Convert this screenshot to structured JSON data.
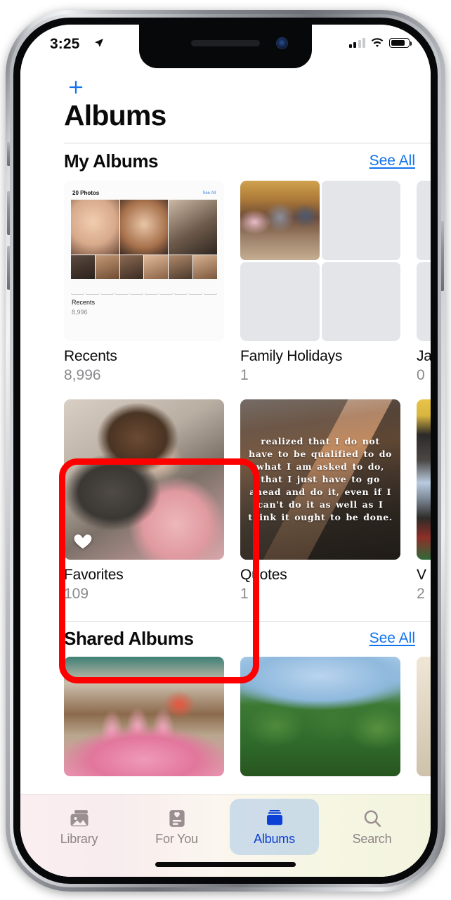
{
  "status_bar": {
    "time": "3:25",
    "location_icon": "location-arrow-icon",
    "cellular_icon": "cellular-bars-icon",
    "cellular_bars_filled": 2,
    "cellular_bars_total": 4,
    "wifi_icon": "wifi-icon",
    "battery_icon": "battery-icon",
    "battery_level_percent": 75
  },
  "nav": {
    "add_icon": "plus-icon",
    "title": "Albums"
  },
  "sections": [
    {
      "title": "My Albums",
      "see_all_label": "See All",
      "rows": [
        [
          {
            "name": "Recents",
            "count": "8,996",
            "thumb": "nested-photos-screenshot"
          },
          {
            "name": "Family Holidays",
            "count": "1",
            "thumb": "quad-grid-family-photo"
          },
          {
            "name": "Ja",
            "count": "0",
            "thumb": "quad-grid-empty",
            "cut_off": true
          }
        ],
        [
          {
            "name": "Favorites",
            "count": "109",
            "thumb": "bunny-photo",
            "badge_icon": "heart-icon",
            "highlighted": true
          },
          {
            "name": "Quotes",
            "count": "1",
            "thumb": "mountain-quote-photo"
          },
          {
            "name": "V",
            "count": "2",
            "thumb": "collage-photo",
            "cut_off": true
          }
        ]
      ]
    },
    {
      "title": "Shared Albums",
      "see_all_label": "See All",
      "shared": [
        {
          "thumb": "birthday-cake-photo"
        },
        {
          "thumb": "green-trees-photo"
        },
        {
          "thumb": "partial-photo",
          "cut_off": true
        }
      ]
    }
  ],
  "quotes_thumb_text": "realized that I do not have to be qualified to do what I am asked to do, that I just have to go ahead and do it, even if I can't do it as well as I think it ought to be done.",
  "recents_nested": {
    "header_count": "20 Photos",
    "header_link": "See All",
    "label": "Recents",
    "count": "8,996"
  },
  "tabbar": {
    "tabs": [
      {
        "label": "Library",
        "icon": "photo-library-icon",
        "active": false
      },
      {
        "label": "For You",
        "icon": "heart-card-icon",
        "active": false
      },
      {
        "label": "Albums",
        "icon": "albums-folder-icon",
        "active": true
      },
      {
        "label": "Search",
        "icon": "search-icon",
        "active": false
      }
    ]
  },
  "annotation": {
    "highlight_color": "#fe0000",
    "target": "Favorites"
  },
  "colors": {
    "accent_blue": "#1072ef",
    "active_tab_blue": "#0b3fd6",
    "secondary_text": "#8a8a8e"
  }
}
